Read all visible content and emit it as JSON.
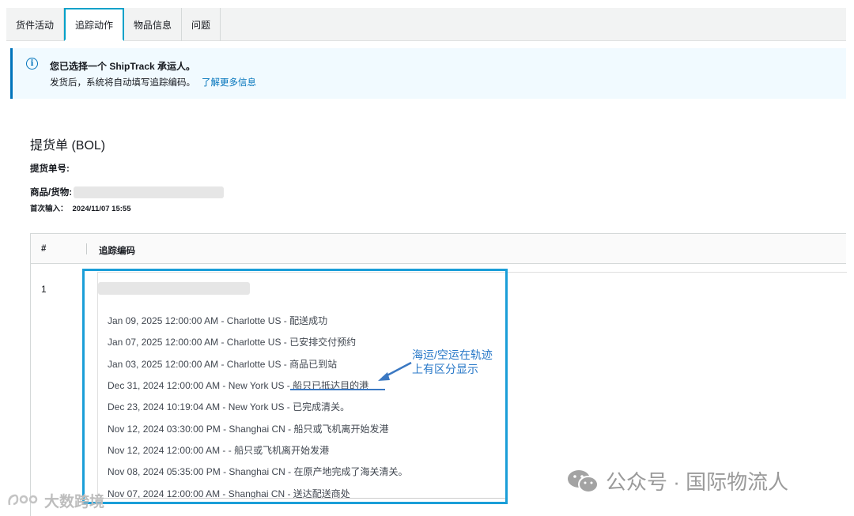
{
  "tabs": [
    {
      "label": "货件活动",
      "active": false
    },
    {
      "label": "追踪动作",
      "active": true
    },
    {
      "label": "物品信息",
      "active": false
    },
    {
      "label": "问题",
      "active": false
    }
  ],
  "alert": {
    "icon": "info-circle-icon",
    "title": "您已选择一个 ShipTrack 承运人。",
    "body": "发货后，系统将自动填写追踪编码。",
    "link": "了解更多信息"
  },
  "bol": {
    "title": "提货单 (BOL)",
    "number_label": "提货单号:",
    "goods_label": "商品/货物:",
    "first_entry_label": "首次输入：",
    "first_entry_value": "2024/11/07 15:55"
  },
  "table": {
    "col_num": "#",
    "col_track": "追踪编码",
    "rows": [
      {
        "num": "1",
        "events": [
          "Jan 09, 2025 12:00:00 AM - Charlotte US - 配送成功",
          "Jan 07, 2025 12:00:00 AM - Charlotte US - 已安排交付预约",
          "Jan 03, 2025 12:00:00 AM - Charlotte US - 商品已到站",
          "Dec 31, 2024 12:00:00 AM - New York US - 船只已抵达目的港",
          "Dec 23, 2024 10:19:04 AM - New York US - 已完成清关。",
          "Nov 12, 2024 03:30:00 PM - Shanghai CN - 船只或飞机离开始发港",
          "Nov 12, 2024 12:00:00 AM - - 船只或飞机离开始发港",
          "Nov 08, 2024 05:35:00 PM - Shanghai CN - 在原产地完成了海关清关。",
          "Nov 07, 2024 12:00:00 AM - Shanghai CN - 送达配送商处"
        ]
      }
    ]
  },
  "annotation": {
    "line1": "海运/空运在轨迹",
    "line2": "上有区分显示",
    "color": "#2878c8"
  },
  "watermarks": {
    "left": "大数跨境",
    "right": "公众号 · 国际物流人"
  },
  "colors": {
    "accent": "#00a1c9",
    "info": "#0073bb",
    "highlight": "#1a9ed8"
  }
}
